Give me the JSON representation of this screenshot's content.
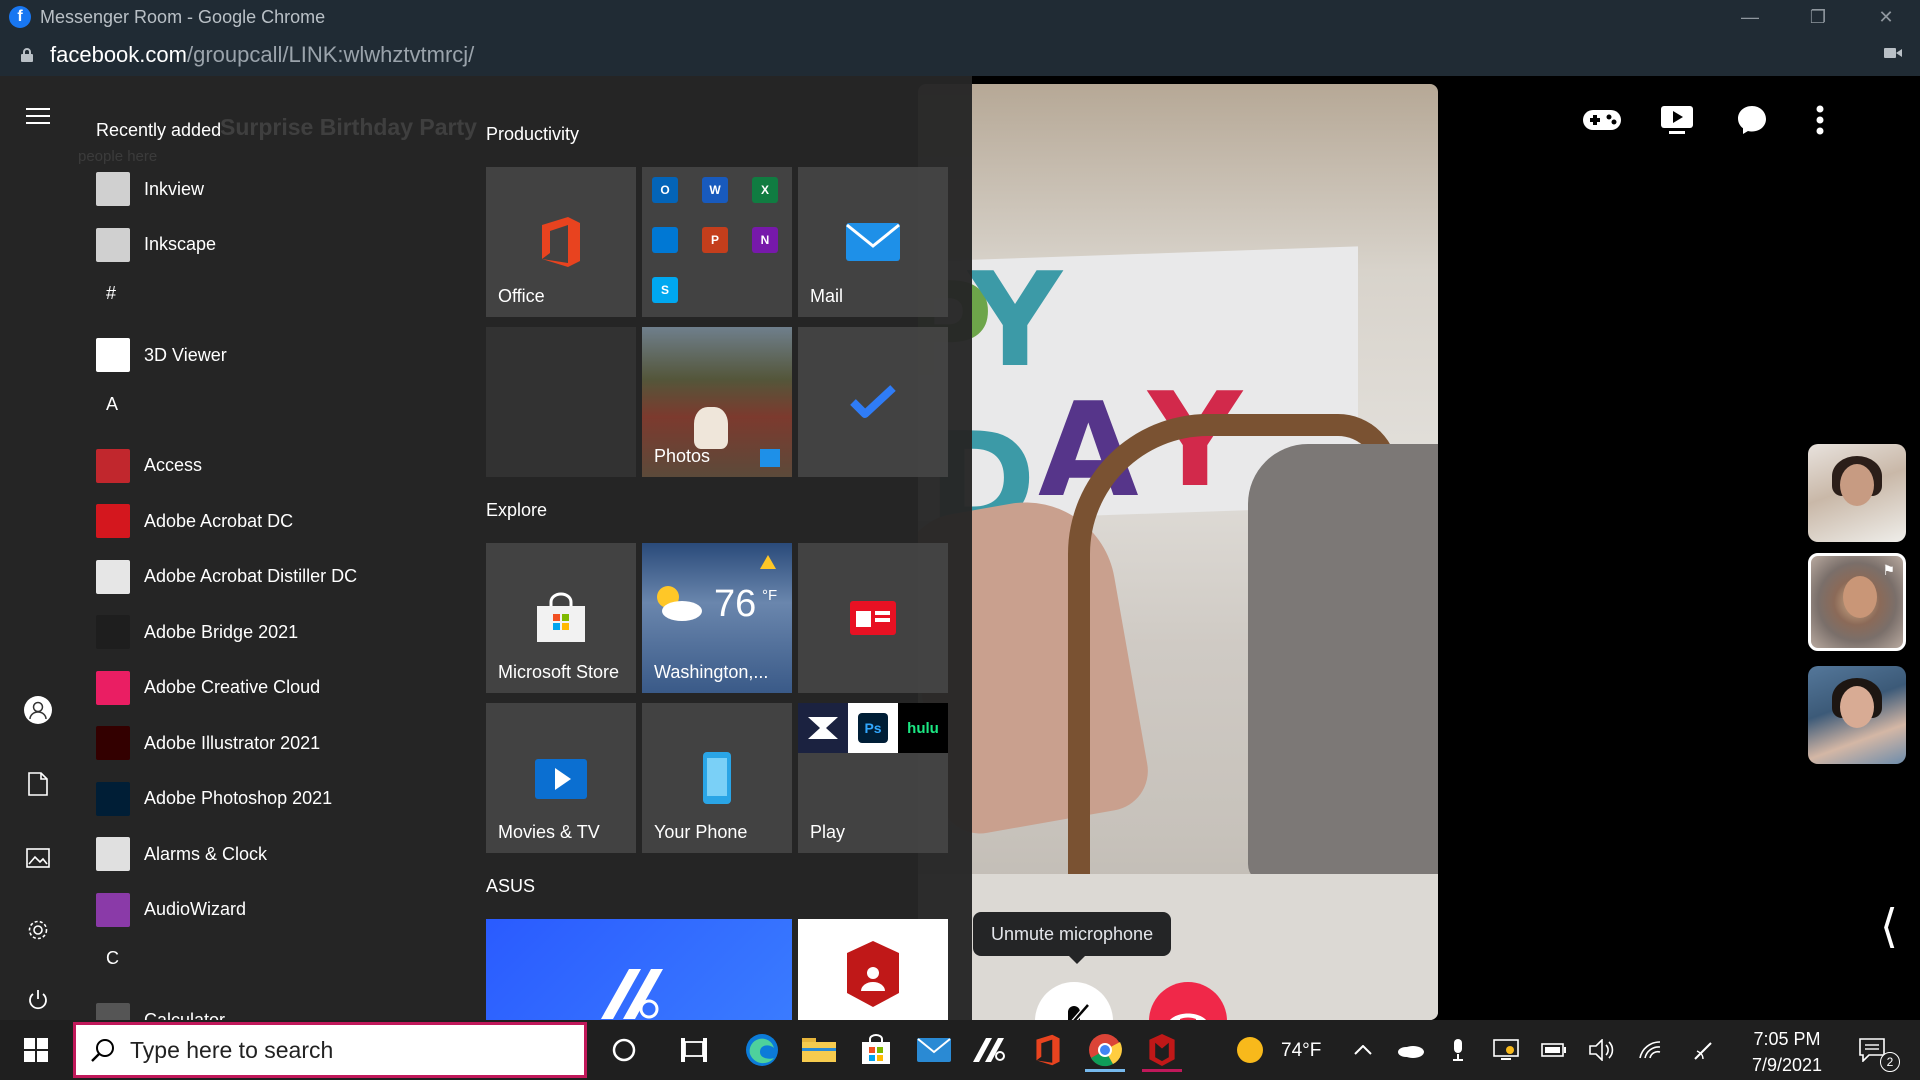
{
  "window": {
    "title": "Messenger Room - Google Chrome",
    "url_host": "facebook.com",
    "url_path": "/groupcall/LINK:wlwhztvtmrcj/"
  },
  "messenger": {
    "ghost_title": "Surprise Birthday Party",
    "ghost_subtitle": "people here",
    "tooltip": "Unmute microphone",
    "top_icons": [
      "gamepad-icon",
      "screen-share-icon",
      "chat-icon",
      "more-icon"
    ]
  },
  "startmenu": {
    "recently_added_label": "Recently added",
    "apps": [
      {
        "label": "Inkview",
        "icon": "inkscape-icon",
        "color": "#d0d0d0"
      },
      {
        "label": "Inkscape",
        "icon": "inkscape-icon",
        "color": "#d0d0d0"
      },
      {
        "letter": "#"
      },
      {
        "label": "3D Viewer",
        "icon": "cube-icon",
        "color": "#ffffff"
      },
      {
        "letter": "A"
      },
      {
        "label": "Access",
        "icon": "access-icon",
        "color": "#c1272d"
      },
      {
        "label": "Adobe Acrobat DC",
        "icon": "acrobat-icon",
        "color": "#d4171e"
      },
      {
        "label": "Adobe Acrobat Distiller DC",
        "icon": "acrobat-distiller-icon",
        "color": "#e6e6e6"
      },
      {
        "label": "Adobe Bridge 2021",
        "icon": "bridge-icon",
        "color": "#1e1e1e"
      },
      {
        "label": "Adobe Creative Cloud",
        "icon": "creative-cloud-icon",
        "color": "#ea1e63"
      },
      {
        "label": "Adobe Illustrator 2021",
        "icon": "illustrator-icon",
        "color": "#330000"
      },
      {
        "label": "Adobe Photoshop 2021",
        "icon": "photoshop-icon",
        "color": "#001e36"
      },
      {
        "label": "Alarms & Clock",
        "icon": "clock-icon",
        "color": "#e0e0e0"
      },
      {
        "label": "AudioWizard",
        "icon": "audiowizard-icon",
        "color": "#8a3aa8"
      },
      {
        "letter": "C"
      },
      {
        "label": "Calculator",
        "icon": "calculator-icon",
        "color": "#555"
      }
    ],
    "groups": {
      "productivity": "Productivity",
      "explore": "Explore",
      "asus": "ASUS"
    },
    "tiles": {
      "office": "Office",
      "mail": "Mail",
      "photos": "Photos",
      "microsoft_store": "Microsoft Store",
      "weather_temp": "76",
      "weather_unit": "°F",
      "weather_city": "Washington,...",
      "movies_tv": "Movies & TV",
      "your_phone": "Your Phone",
      "play": "Play"
    },
    "office_minis": [
      {
        "letter": "O",
        "color": "#0364b8"
      },
      {
        "letter": "W",
        "color": "#185abd"
      },
      {
        "letter": "X",
        "color": "#107c41"
      },
      {
        "letter": "",
        "color": "#0078d4"
      },
      {
        "letter": "P",
        "color": "#c43e1c"
      },
      {
        "letter": "N",
        "color": "#7719aa"
      },
      {
        "letter": "S",
        "color": "#00a8f0"
      }
    ],
    "play_minis": [
      "hulu"
    ]
  },
  "taskbar": {
    "search_placeholder": "Type here to search",
    "weather": "74°F",
    "time": "7:05 PM",
    "date": "7/9/2021",
    "notification_count": "2"
  }
}
